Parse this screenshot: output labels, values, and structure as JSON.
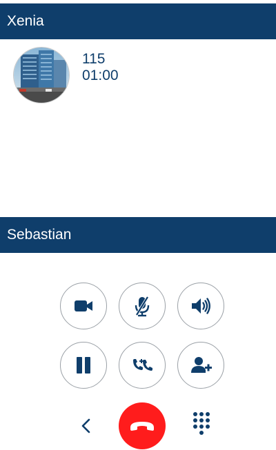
{
  "active_call": {
    "name": "Xenia",
    "number": "115",
    "duration": "01:00"
  },
  "held_call": {
    "name": "Sebastian"
  },
  "controls": {
    "row1": [
      "video-icon",
      "mute-microphone-icon",
      "speaker-icon"
    ],
    "row2": [
      "pause-icon",
      "transfer-call-icon",
      "add-participant-icon"
    ],
    "bottom": [
      "back-chevron-icon",
      "hangup-phone-icon",
      "keypad-icon"
    ]
  },
  "colors": {
    "header_bar": "#0f3e6b",
    "icon": "#0f3e6b",
    "hangup": "#ff1c1c",
    "button_border": "#9aa0a6"
  }
}
